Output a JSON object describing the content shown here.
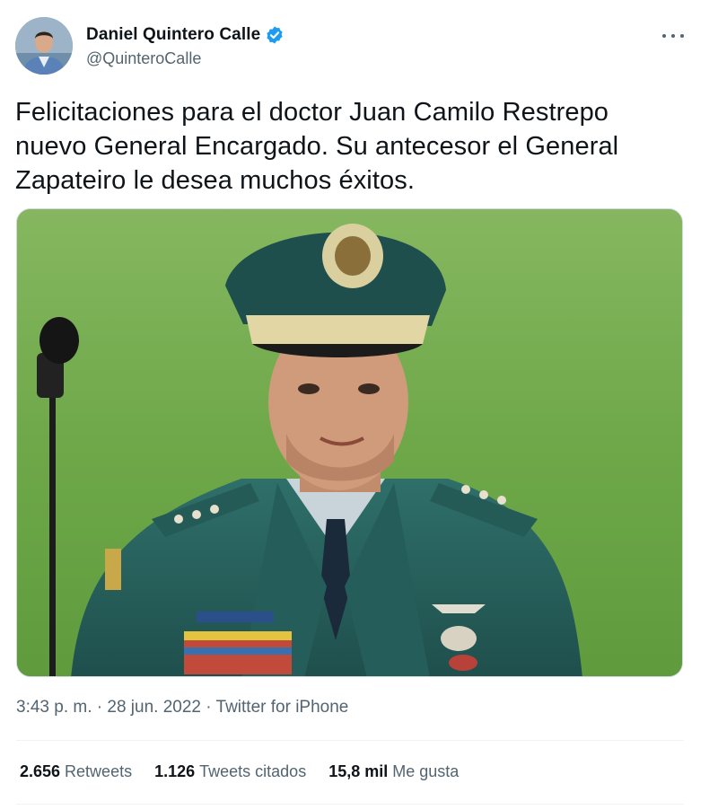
{
  "user": {
    "display_name": "Daniel Quintero Calle",
    "handle": "@QuinteroCalle",
    "verified": true
  },
  "tweet": {
    "text": "Felicitaciones para el doctor Juan Camilo Restrepo nuevo General Encargado. Su antecesor el General Zapateiro le desea muchos éxitos.",
    "time": "3:43 p. m.",
    "separator": "·",
    "date": "28 jun. 2022",
    "source": "Twitter for iPhone"
  },
  "stats": {
    "retweets_count": "2.656",
    "retweets_label": "Retweets",
    "quotes_count": "1.126",
    "quotes_label": "Tweets citados",
    "likes_count": "15,8 mil",
    "likes_label": "Me gusta"
  },
  "colors": {
    "verified_blue": "#1d9bf0",
    "secondary_text": "#536471",
    "primary_text": "#0f1419"
  },
  "icons": {
    "verified": "verified-badge-icon",
    "more": "more-options-icon"
  }
}
